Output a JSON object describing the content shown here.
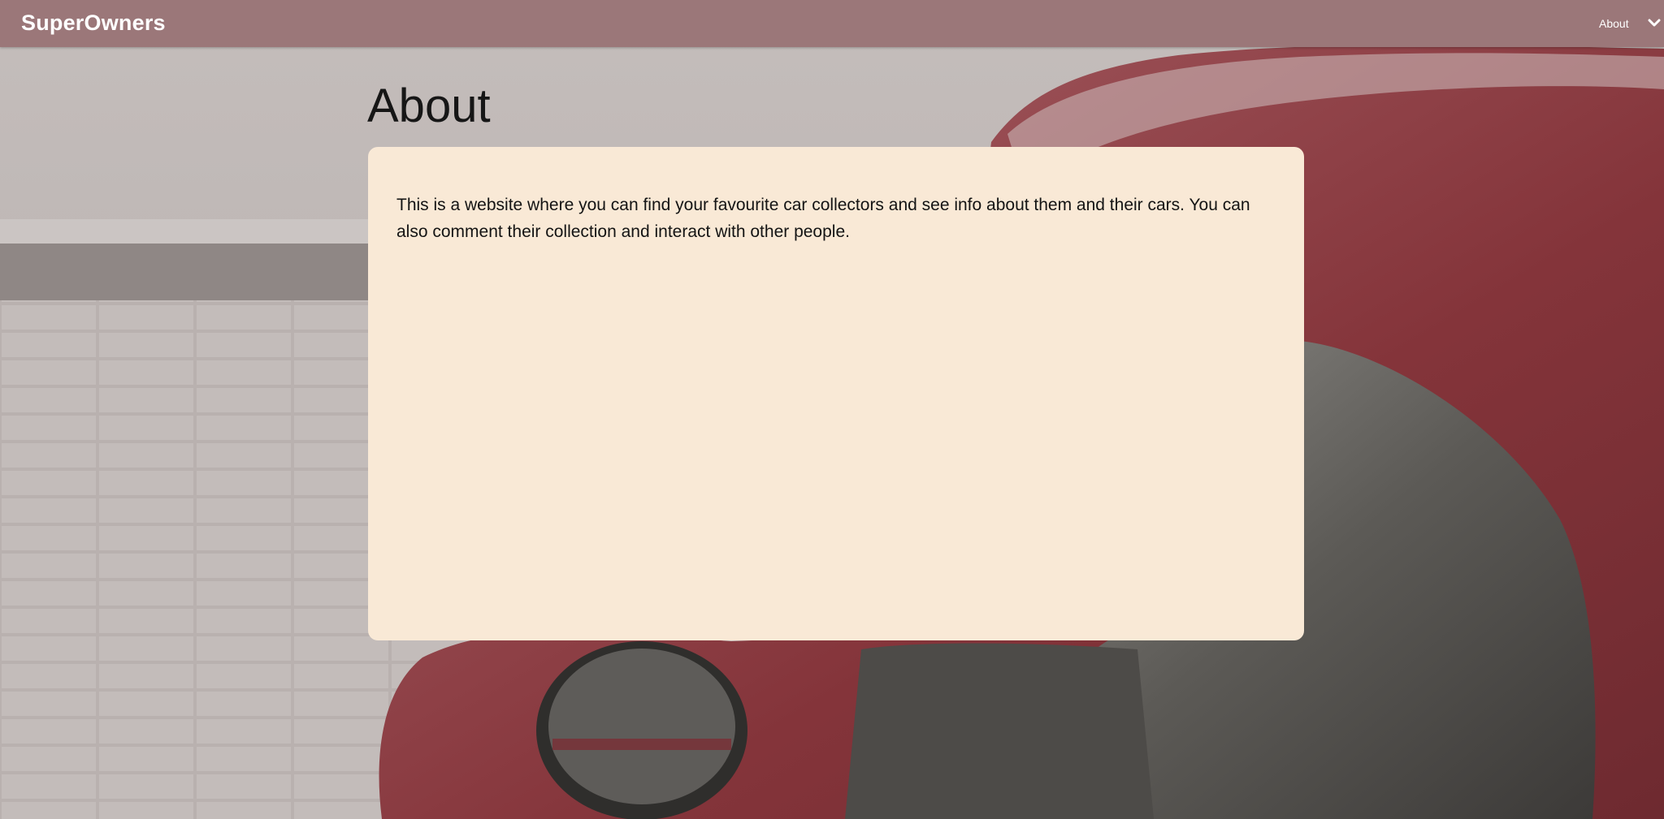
{
  "navbar": {
    "brand": "SuperOwners",
    "links": [
      {
        "label": "About"
      }
    ],
    "toggle_icon": "chevron-down-icon"
  },
  "main": {
    "title": "About",
    "description": "This is a website where you can find your favourite car collectors and see info about them and their cars. You can also comment their collection and interact with other people."
  },
  "colors": {
    "navbar_bg": "#9b7779",
    "card_bg": "#f9e9d6",
    "car_red": "#8a3a3f"
  }
}
